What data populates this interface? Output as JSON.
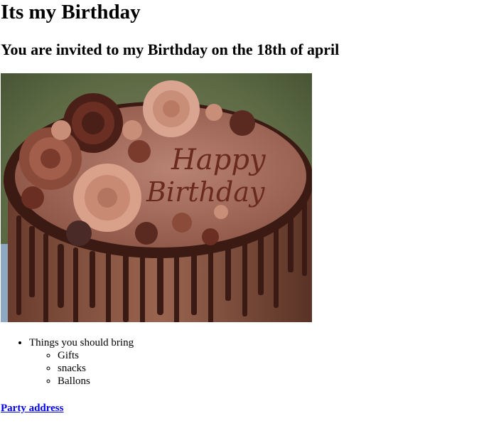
{
  "heading": "Its my Birthday",
  "subheading": "You are invited to my Birthday on the 18th of april",
  "image": {
    "alt": "Chocolate birthday cake",
    "cake_text_line1": "Happy",
    "cake_text_line2": "Birthday"
  },
  "list": {
    "title": "Things you should bring",
    "items": [
      "Gifts",
      "snacks",
      "Ballons"
    ]
  },
  "link": {
    "label": "Party address"
  },
  "colors": {
    "link": "#0000ee",
    "text": "#000000",
    "background": "#ffffff"
  }
}
